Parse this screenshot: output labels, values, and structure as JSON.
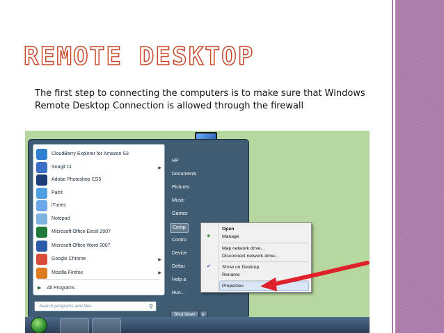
{
  "slide": {
    "title": "Remote Desktop",
    "body": "The first step to connecting the computers is to make sure that Windows Remote Desktop Connection is allowed through the firewall"
  },
  "start_menu": {
    "programs": [
      {
        "label": "CloudBerry Explorer for Amazon S3",
        "icon": "cloud-icon",
        "color": "#2f7fd1",
        "has_submenu": false
      },
      {
        "label": "Snagit 11",
        "icon": "snagit-icon",
        "color": "#3a6fc6",
        "has_submenu": true
      },
      {
        "label": "Adobe Photoshop CS5",
        "icon": "photoshop-icon",
        "color": "#1c3d78",
        "has_submenu": false
      },
      {
        "label": "Paint",
        "icon": "paint-icon",
        "color": "#4f9fe0",
        "has_submenu": false
      },
      {
        "label": "iTunes",
        "icon": "itunes-icon",
        "color": "#6aa7e8",
        "has_submenu": false
      },
      {
        "label": "Notepad",
        "icon": "notepad-icon",
        "color": "#7fb4e0",
        "has_submenu": false
      },
      {
        "label": "Microsoft Office Excel 2007",
        "icon": "excel-icon",
        "color": "#1f7a3a",
        "has_submenu": false
      },
      {
        "label": "Microsoft Office Word 2007",
        "icon": "word-icon",
        "color": "#2a5aa8",
        "has_submenu": false
      },
      {
        "label": "Google Chrome",
        "icon": "chrome-icon",
        "color": "#d94a38",
        "has_submenu": true
      },
      {
        "label": "Mozilla Firefox",
        "icon": "firefox-icon",
        "color": "#e07a1f",
        "has_submenu": true
      }
    ],
    "all_programs": "All Programs",
    "search_placeholder": "Search programs and files",
    "right_items": [
      "HP",
      "Documents",
      "Pictures",
      "Music",
      "Games",
      "Comp",
      "Contro",
      "Device",
      "Defau",
      "Help a",
      "Run..."
    ],
    "shutdown": "Shut down"
  },
  "context_menu": {
    "items": [
      "Open",
      "Manage",
      "Map network drive...",
      "Disconnect network drive...",
      "Show on Desktop",
      "Rename",
      "Properties"
    ]
  },
  "colors": {
    "title_outline": "#c9482c",
    "sidebar": "#a97aa8",
    "arrow": "#e0202a"
  }
}
